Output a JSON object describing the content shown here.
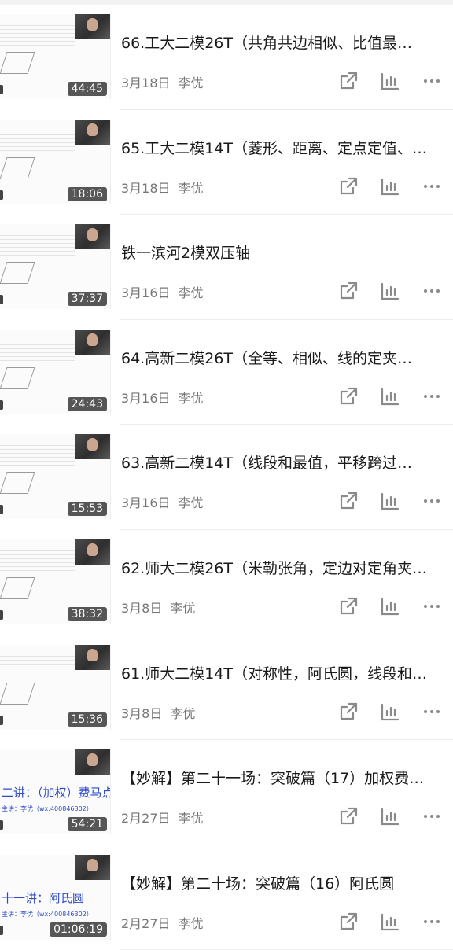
{
  "videos": [
    {
      "title": "66.工大二模26T（共角共边相似、比值最…",
      "date": "3月18日",
      "author": "李优",
      "duration": "44:45",
      "thumb": "doc"
    },
    {
      "title": "65.工大二模14T（菱形、距离、定点定值、…",
      "date": "3月18日",
      "author": "李优",
      "duration": "18:06",
      "thumb": "doc"
    },
    {
      "title": "铁一滨河2模双压轴",
      "date": "3月16日",
      "author": "李优",
      "duration": "37:37",
      "thumb": "doc"
    },
    {
      "title": "64.高新二模26T（全等、相似、线的定夹…",
      "date": "3月16日",
      "author": "李优",
      "duration": "24:43",
      "thumb": "doc"
    },
    {
      "title": "63.高新二模14T（线段和最值，平移跨过…",
      "date": "3月16日",
      "author": "李优",
      "duration": "15:53",
      "thumb": "doc"
    },
    {
      "title": "62.师大二模26T（米勒张角，定边对定角夹…",
      "date": "3月8日",
      "author": "李优",
      "duration": "38:32",
      "thumb": "doc"
    },
    {
      "title": "61.师大二模14T（对称性，阿氏圆，线段和…",
      "date": "3月8日",
      "author": "李优",
      "duration": "15:36",
      "thumb": "doc"
    },
    {
      "title": "【妙解】第二十一场：突破篇（17）加权费…",
      "date": "2月27日",
      "author": "李优",
      "duration": "54:21",
      "thumb": "lecture",
      "lecture_title": "二讲：（加权）费马点",
      "lecture_sub": "主讲：李优（wx:400846302）"
    },
    {
      "title": "【妙解】第二十场：突破篇（16）阿氏圆",
      "date": "2月27日",
      "author": "李优",
      "duration": "01:06:19",
      "thumb": "lecture",
      "lecture_title": "十一讲：阿氏圆",
      "lecture_sub": "主讲：李优（wx:400846302）"
    }
  ],
  "icons": {
    "share": "share-icon",
    "stats": "bar-chart-icon",
    "more": "more-icon"
  },
  "colors": {
    "text": "#1a1a1a",
    "meta": "#777777",
    "icon": "#8a8a8a",
    "lecture": "#2d49c9"
  }
}
